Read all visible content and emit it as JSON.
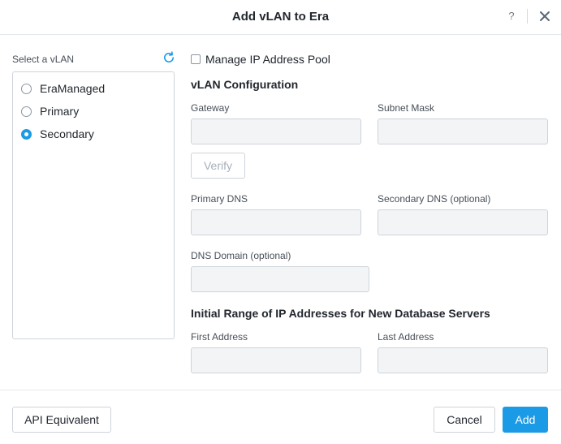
{
  "dialog": {
    "title": "Add vLAN to Era",
    "help_label": "?",
    "icons": {
      "close": "close-icon",
      "refresh": "refresh-icon"
    }
  },
  "vlan_list": {
    "label": "Select a vLAN",
    "items": [
      {
        "label": "EraManaged",
        "selected": false
      },
      {
        "label": "Primary",
        "selected": false
      },
      {
        "label": "Secondary",
        "selected": true
      }
    ]
  },
  "manage_pool": {
    "label": "Manage IP Address Pool",
    "checked": false
  },
  "vlan_config": {
    "title": "vLAN Configuration",
    "gateway": {
      "label": "Gateway",
      "value": ""
    },
    "subnet_mask": {
      "label": "Subnet Mask",
      "value": ""
    },
    "verify_label": "Verify",
    "primary_dns": {
      "label": "Primary DNS",
      "value": ""
    },
    "secondary_dns": {
      "label": "Secondary DNS (optional)",
      "value": ""
    },
    "dns_domain": {
      "label": "DNS Domain (optional)",
      "value": ""
    }
  },
  "ip_range": {
    "title": "Initial Range of IP Addresses for New Database Servers",
    "first_address": {
      "label": "First Address",
      "value": ""
    },
    "last_address": {
      "label": "Last Address",
      "value": ""
    }
  },
  "footer": {
    "api_label": "API Equivalent",
    "cancel_label": "Cancel",
    "add_label": "Add"
  },
  "colors": {
    "accent": "#1b9be6",
    "input_bg": "#f2f4f6",
    "border": "#ced4da"
  }
}
